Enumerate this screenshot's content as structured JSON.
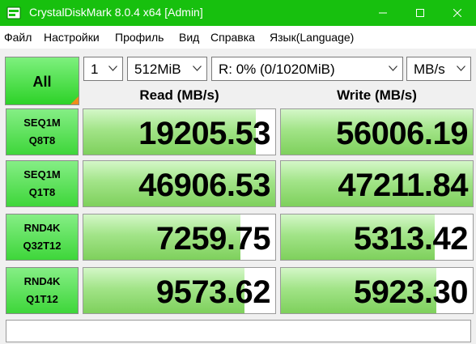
{
  "window": {
    "title": "CrystalDiskMark 8.0.4 x64 [Admin]",
    "title_color": "#17c00e"
  },
  "menu": {
    "items": [
      "Файл",
      "Настройки",
      "Профиль",
      "Вид",
      "Справка",
      "Язык(Language)"
    ]
  },
  "controls": {
    "all_label": "All",
    "count": "1",
    "size": "512MiB",
    "drive": "R: 0% (0/1020MiB)",
    "unit": "MB/s"
  },
  "headers": {
    "read": "Read (MB/s)",
    "write": "Write (MB/s)"
  },
  "tests": [
    {
      "line1": "SEQ1M",
      "line2": "Q8T8",
      "read": "19205.53",
      "write": "56006.19",
      "read_fill": 0.9,
      "write_fill": 1.0
    },
    {
      "line1": "SEQ1M",
      "line2": "Q1T8",
      "read": "46906.53",
      "write": "47211.84",
      "read_fill": 1.0,
      "write_fill": 1.0
    },
    {
      "line1": "RND4K",
      "line2": "Q32T12",
      "read": "7259.75",
      "write": "5313.42",
      "read_fill": 0.82,
      "write_fill": 0.8
    },
    {
      "line1": "RND4K",
      "line2": "Q1T12",
      "read": "9573.62",
      "write": "5923.30",
      "read_fill": 0.84,
      "write_fill": 0.81
    }
  ],
  "status_text": ""
}
